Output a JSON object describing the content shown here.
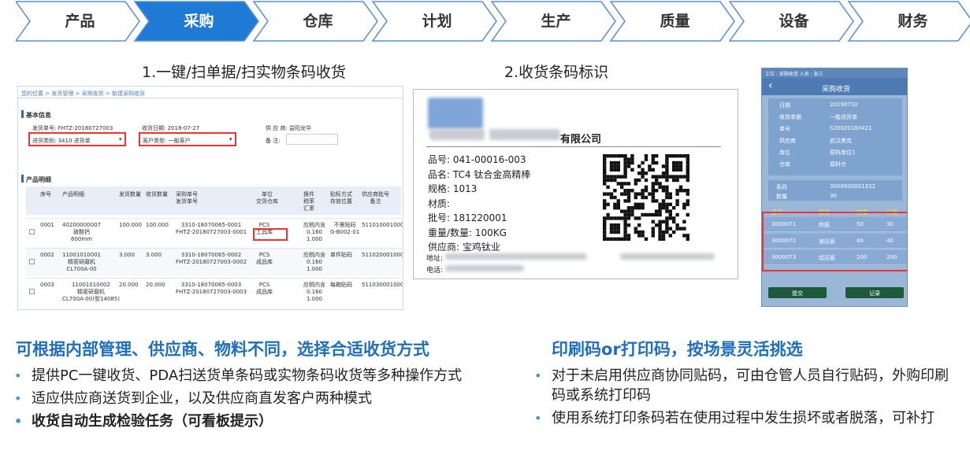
{
  "nav": {
    "steps": [
      "产品",
      "采购",
      "仓库",
      "计划",
      "生产",
      "质量",
      "设备",
      "财务"
    ],
    "active_index": 1,
    "active_color": "#1f7ad6",
    "inactive_color": "#ffffff",
    "border_color": "#5a8fd0"
  },
  "captions": {
    "left": "1.一键/扫单据/扫实物条码收货",
    "middle": "2.收货条码标识"
  },
  "pc_screen": {
    "breadcrumb": "您的位置 > 发货管理 > 采购收货 > 新建采购收货",
    "basic_title": "基本信息",
    "ship_no": "发货单号: FHTZ-20180727003",
    "receive_date": "收货日期: 2018-07-27",
    "supplier": "供 应 商: 益阳龙华",
    "in_type": "进货类别: 3410 进货单",
    "cust_type": "客户类型: 一般客户",
    "remark": "备 注:",
    "detail_title": "产品明细",
    "columns": [
      "序号",
      "产品明细",
      "发货数量",
      "收货数量",
      "采购单号\n发货单号",
      "单位\n交货仓库",
      "换件\n税率\n汇率",
      "贴标方式\n存放位置",
      "供应商批号\n备注"
    ],
    "rows": [
      [
        "0001",
        "40200000007\n硫酸钙\n600mm",
        "100.000",
        "100.000",
        "3310-18070065-0001\nFHTZ-20180727003-0001",
        "PCS\n工具库",
        "应税内含\n0.160\n1.000",
        "不需贴码\nG-B002-01",
        "5110100010005"
      ],
      [
        "0002",
        "11001010001\n精密研磨机\nCL700A-00",
        "3.000",
        "3.000",
        "3310-18070065-0002\nFHTZ-20180727003-0002",
        "PCS\n成品库",
        "应税内含\n0.160\n1.000",
        "单件贴码",
        "5110200010005"
      ],
      [
        "0003",
        "11001010002\n精密研磨机\nCL700A-00(型14085)",
        "20.000",
        "20.000",
        "3310-18070065-0003\nFHTZ-20180727003-0003",
        "PCS\n成品库",
        "应税内含\n0.160\n1.000",
        "每箱贴码",
        "5110300010005"
      ]
    ]
  },
  "label": {
    "company": "有限公司",
    "lines": [
      "品号: 041-00016-003",
      "品名: TC4 钛合金高精棒",
      "规格: 1013",
      "材质:",
      "批号: 181220001",
      "重量/数量: 100KG",
      "供应商: 宝鸡钛业"
    ],
    "addr": "地址:",
    "tel": "电话:"
  },
  "pda": {
    "status": "工位 : 采购收货  人员 : 张三",
    "title": "采购收货",
    "fields": [
      [
        "日期",
        "20190710"
      ],
      [
        "收货单据",
        "一般进货单"
      ],
      [
        "单号",
        "S20020180421"
      ],
      [
        "供应商",
        "武汉美克"
      ],
      [
        "库位",
        "原料库位1"
      ],
      [
        "仓库",
        "原料仓"
      ]
    ],
    "barcode_label": "条码",
    "barcode_value": "3000600001332",
    "qty_label": "数量",
    "qty_value": "30",
    "table_head": [
      "品号",
      "品名",
      "应收",
      "已收"
    ],
    "table_rows": [
      [
        "3000071",
        "热板",
        "50",
        "30"
      ],
      [
        "3000072",
        "液压板",
        "40",
        "40"
      ],
      [
        "3000073",
        "铝压板",
        "200",
        "200"
      ]
    ],
    "submit": "提交",
    "record": "记录"
  },
  "left_section": {
    "heading": "可根据内部管理、供应商、物料不同，选择合适收货方式",
    "bullets": [
      "提供PC一键收货、PDA扫送货单条码或实物条码收货等多种操作方式",
      "适应供应商送货到企业，以及供应商直发客户两种模式",
      "收货自动生成检验任务（可看板提示）"
    ]
  },
  "right_section": {
    "heading": "印刷码or打印码，按场景灵活挑选",
    "bullets": [
      "对于未启用供应商协同贴码，可由仓管人员自行贴码，外购印刷码或系统打印码",
      "使用系统打印条码若在使用过程中发生损坏或者脱落，可补打"
    ]
  }
}
